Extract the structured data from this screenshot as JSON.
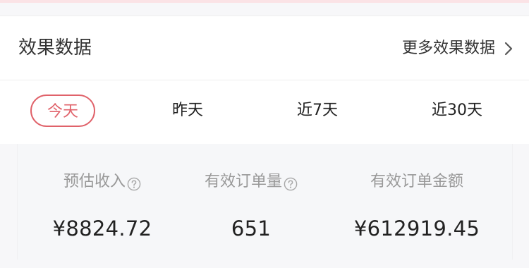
{
  "header": {
    "title": "效果数据",
    "more_label": "更多效果数据"
  },
  "tabs": [
    {
      "label": "今天",
      "active": true
    },
    {
      "label": "昨天",
      "active": false
    },
    {
      "label": "近7天",
      "active": false
    },
    {
      "label": "近30天",
      "active": false
    }
  ],
  "stats": [
    {
      "label": "预估收入",
      "value": "¥8824.72",
      "has_help": true
    },
    {
      "label": "有效订单量",
      "value": "651",
      "has_help": true
    },
    {
      "label": "有效订单金额",
      "value": "¥612919.45",
      "has_help": false
    }
  ],
  "colors": {
    "accent": "#e0626a",
    "label_gray": "#999999",
    "value_dark": "#222222",
    "panel_bg": "#f6f7f9"
  }
}
